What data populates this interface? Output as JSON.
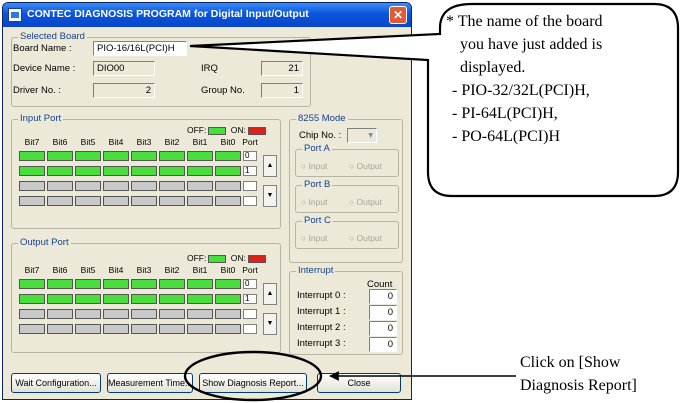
{
  "window": {
    "title": "CONTEC DIAGNOSIS PROGRAM for Digital Input/Output",
    "close_glyph": "✕"
  },
  "selected_board": {
    "group_label": "Selected Board",
    "board_name_label": "Board Name :",
    "board_name_value": "PIO-16/16L(PCI)H",
    "device_name_label": "Device Name :",
    "device_name_value": "DIO00",
    "irq_label": "IRQ",
    "irq_value": "21",
    "driver_no_label": "Driver No. :",
    "driver_no_value": "2",
    "group_no_label": "Group No.",
    "group_no_value": "1"
  },
  "input_port": {
    "group_label": "Input Port",
    "off_label": "OFF:",
    "on_label": "ON:",
    "bit_headers": [
      "Bit7",
      "Bit6",
      "Bit5",
      "Bit4",
      "Bit3",
      "Bit2",
      "Bit1",
      "Bit0"
    ],
    "port_header": "Port",
    "rows": [
      {
        "state": "on",
        "port": "0"
      },
      {
        "state": "on",
        "port": "1"
      },
      {
        "state": "off",
        "port": ""
      },
      {
        "state": "off",
        "port": ""
      }
    ]
  },
  "output_port": {
    "group_label": "Output Port",
    "off_label": "OFF:",
    "on_label": "ON:",
    "bit_headers": [
      "Bit7",
      "Bit6",
      "Bit5",
      "Bit4",
      "Bit3",
      "Bit2",
      "Bit1",
      "Bit0"
    ],
    "port_header": "Port",
    "rows": [
      {
        "state": "on",
        "port": "0"
      },
      {
        "state": "on",
        "port": "1"
      },
      {
        "state": "off",
        "port": ""
      },
      {
        "state": "off",
        "port": ""
      }
    ]
  },
  "mode_8255": {
    "group_label": "8255 Mode",
    "chip_no_label": "Chip No. :",
    "port_a_label": "Port A",
    "port_b_label": "Port B",
    "port_c_label": "Port C",
    "input_option": "Input",
    "output_option": "Output"
  },
  "interrupt": {
    "group_label": "Interrupt",
    "count_header": "Count",
    "rows": [
      {
        "label": "Interrupt 0 :",
        "count": "0"
      },
      {
        "label": "Interrupt 1 :",
        "count": "0"
      },
      {
        "label": "Interrupt 2 :",
        "count": "0"
      },
      {
        "label": "Interrupt 3 :",
        "count": "0"
      }
    ]
  },
  "buttons": {
    "wait_configuration": "Wait Configuration...",
    "measurement_time": "Measurement Time...",
    "show_diagnosis_report": "Show Diagnosis Report...",
    "close": "Close"
  },
  "callout": {
    "lines": [
      "* The name of the board",
      "you have just added is",
      "displayed.",
      "- PIO-32/32L(PCI)H,",
      "- PI-64L(PCI)H,",
      "- PO-64L(PCI)H"
    ]
  },
  "caption": {
    "line1": "Click on [Show",
    "line2": "Diagnosis Report]"
  },
  "colors": {
    "on_indicator": "#4ade3d",
    "off_indicator": "#c8c8c8",
    "on_swatch": "#e02020",
    "off_swatch": "#4ade3d"
  }
}
